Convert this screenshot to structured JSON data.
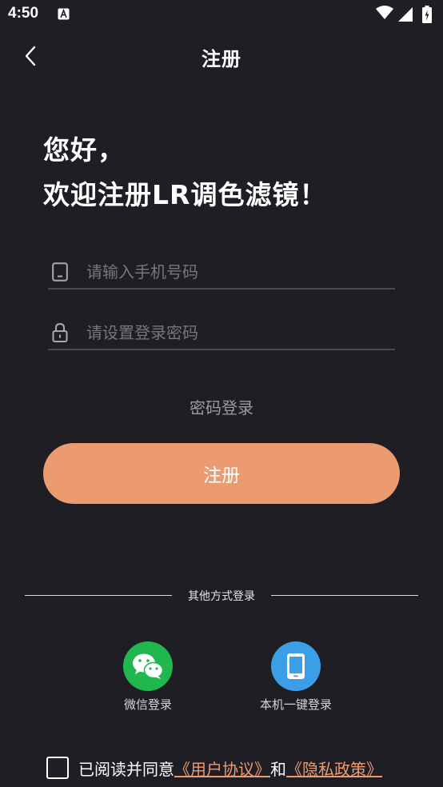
{
  "status_bar": {
    "time": "4:50"
  },
  "nav": {
    "title": "注册"
  },
  "greeting": {
    "line1": "您好，",
    "line2": "欢迎注册LR调色滤镜！"
  },
  "form": {
    "phone_placeholder": "请输入手机号码",
    "phone_value": "",
    "password_placeholder": "请设置登录密码",
    "password_value": ""
  },
  "password_login_label": "密码登录",
  "register_label": "注册",
  "other_login": {
    "divider_label": "其他方式登录",
    "options": [
      {
        "label": "微信登录",
        "icon": "wechat-icon",
        "color": "#1fb74e"
      },
      {
        "label": "本机一键登录",
        "icon": "phone-icon",
        "color": "#3d9ee8"
      }
    ]
  },
  "agreement": {
    "prefix": "已阅读并同意",
    "user_agreement": "《用户协议》",
    "conjunction": "和",
    "privacy_policy": "《隐私政策》"
  },
  "colors": {
    "background": "#1f1e24",
    "accent": "#ec9a70"
  }
}
